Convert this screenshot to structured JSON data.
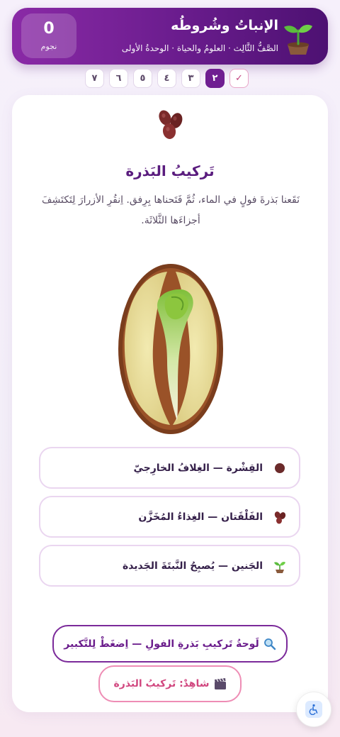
{
  "header": {
    "title": "الإنباتُ وشُروطُه",
    "subtitle": "الصَّفُّ الثَّالِث · العلومُ والحياة · الوحدةُ الأولى",
    "stars_count": "0",
    "stars_label": "نجوم",
    "icon": "sprout-icon"
  },
  "steps": {
    "done_mark": "✓",
    "current": "٢",
    "items": [
      "٣",
      "٤",
      "٥",
      "٦",
      "٧"
    ]
  },
  "card": {
    "icon": "beans-icon",
    "title": "تَركيبُ البَذرة",
    "description": "نَقَعنا بَذرةَ فولٍ في الماء، ثُمَّ فَتَحناها بِرِفق. اِنقُرِ الأزرارَ لِتَكتَشِفَ أجزاءَها الثَّلاثَة.",
    "parts": [
      {
        "label": "القِشْرة — الغِلافُ الخارِجيّ",
        "icon": "dot-icon"
      },
      {
        "label": "الفَلْقَتان — الغِذاءُ المُخَزَّن",
        "icon": "beans-icon"
      },
      {
        "label": "الجَنين — يُصبِحُ النَّبتَةَ الجَديدة",
        "icon": "seedling-icon"
      }
    ],
    "zoom_button": "لَوحةُ تَركيبِ بَذرةِ الفولِ — اِضغَطْ لِلتَّكبير",
    "watch_button": "شاهِدْ: تَركيبُ البَذرة"
  },
  "colors": {
    "brand_purple": "#6f1e91",
    "accent_pink": "#d1477f"
  }
}
